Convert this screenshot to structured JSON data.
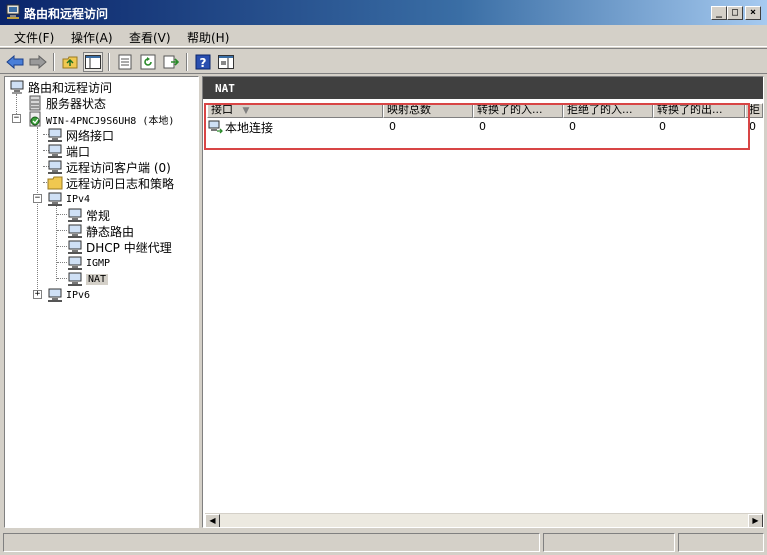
{
  "window": {
    "title": "路由和远程访问"
  },
  "menu": [
    {
      "label": "文件(F)"
    },
    {
      "label": "操作(A)"
    },
    {
      "label": "查看(V)"
    },
    {
      "label": "帮助(H)"
    }
  ],
  "toolbar": {
    "buttons": [
      "back-icon",
      "forward-icon",
      "up-folder-icon",
      "show-tree-icon",
      "properties-icon",
      "refresh-icon",
      "export-icon",
      "help-icon",
      "console-icon"
    ]
  },
  "tree": {
    "root": "路由和远程访问",
    "server_status": "服务器状态",
    "server": "WIN-4PNCJ9S6UH8 (本地)",
    "network_interfaces": "网络接口",
    "ports": "端口",
    "remote_clients": "远程访问客户端 (0)",
    "remote_logging": "远程访问日志和策略",
    "ipv4": "IPv4",
    "general": "常规",
    "static_routes": "静态路由",
    "dhcp_relay": "DHCP 中继代理",
    "igmp": "IGMP",
    "nat": "NAT",
    "ipv6": "IPv6"
  },
  "panel": {
    "header": "NAT",
    "columns": [
      "接口",
      "映射总数",
      "转换了的入...",
      "拒绝了的入...",
      "转换了的出...",
      "拒"
    ],
    "rows": [
      {
        "interface": "本地连接",
        "mappings": "0",
        "inbound_translated": "0",
        "inbound_rejected": "0",
        "outbound_translated": "0",
        "extra": "0"
      }
    ]
  }
}
